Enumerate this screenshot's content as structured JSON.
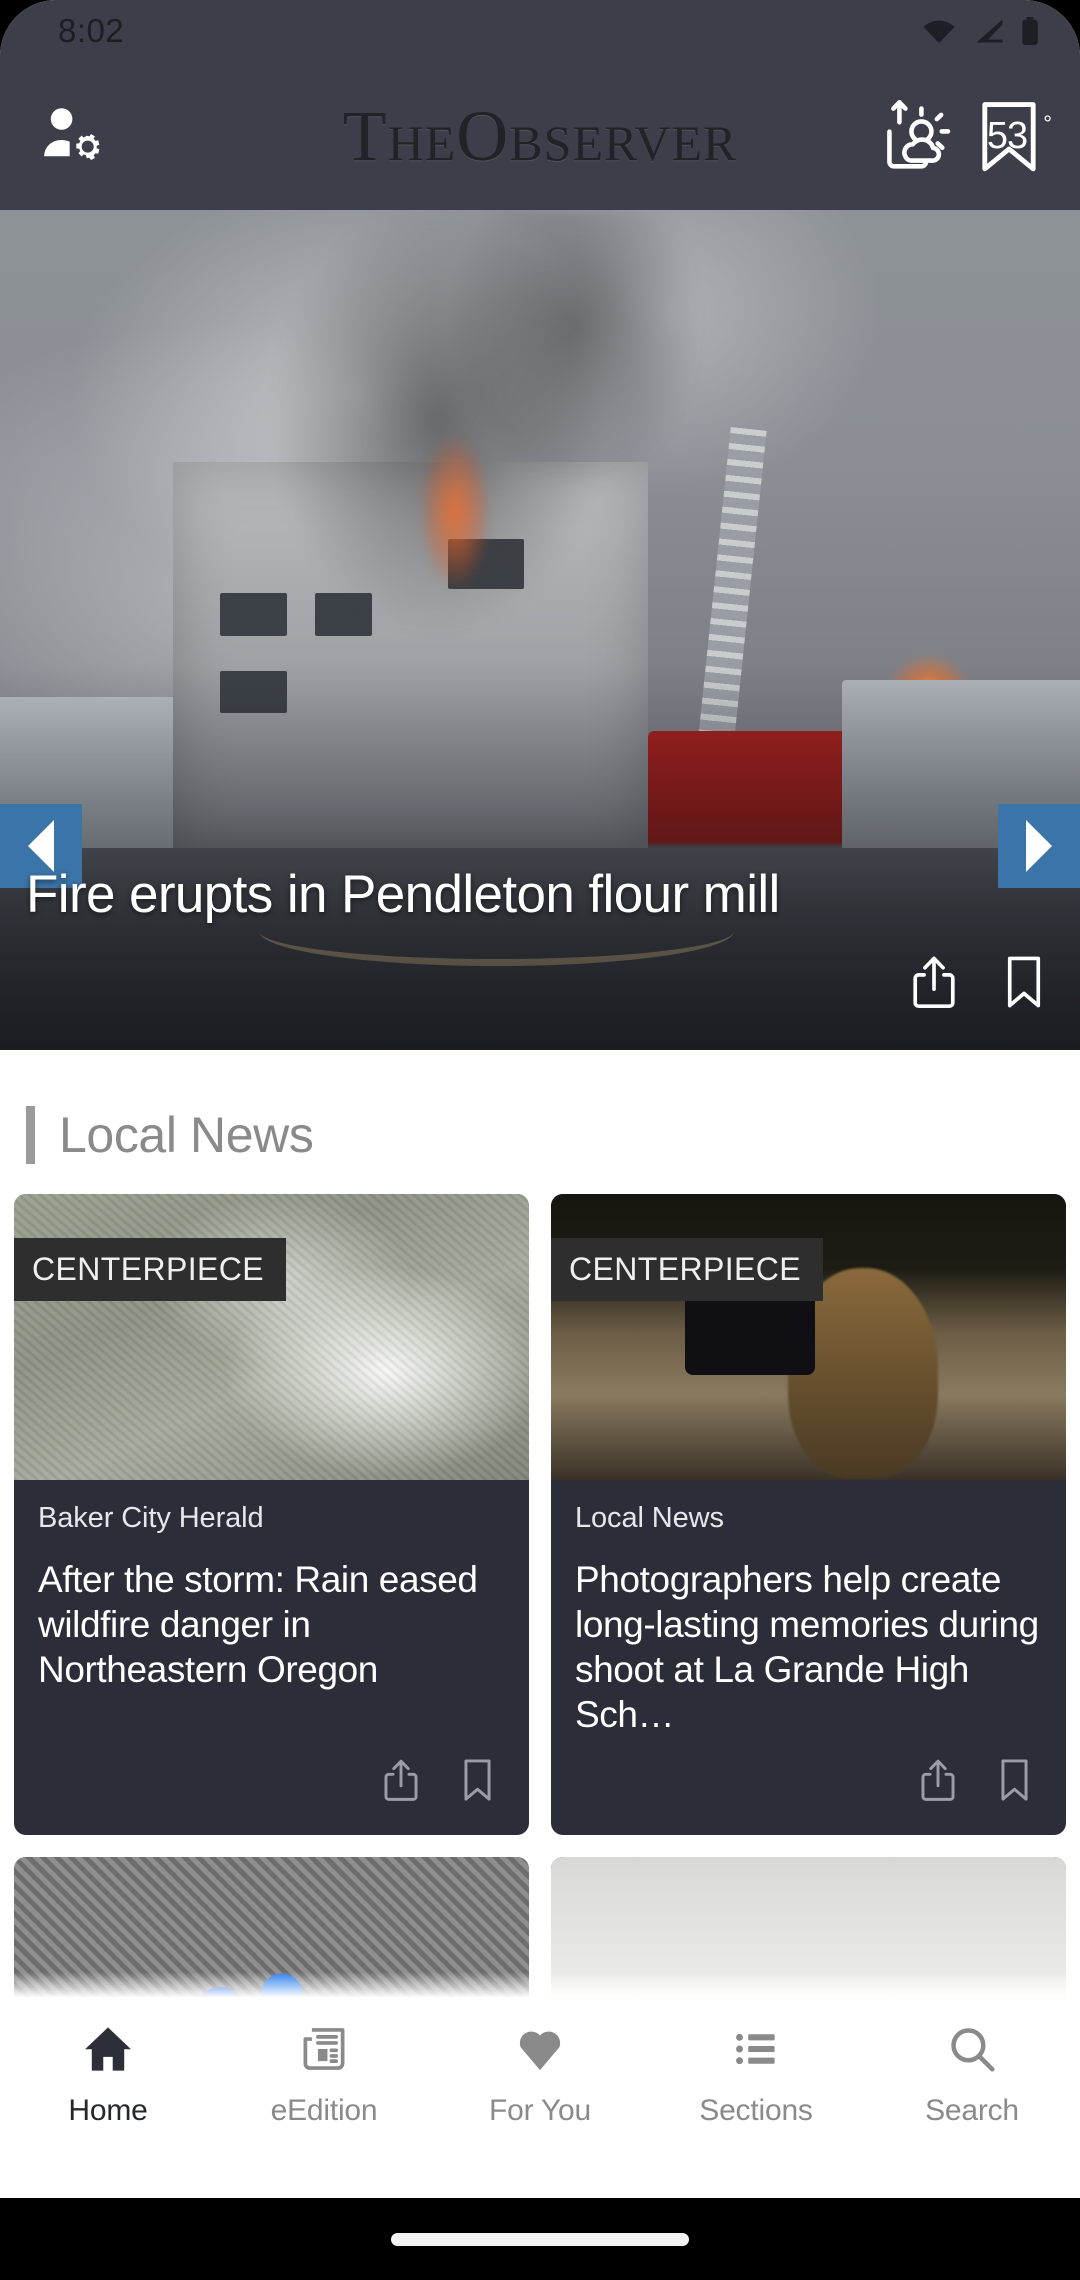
{
  "status_bar": {
    "time": "8:02",
    "icons": [
      "wifi-icon",
      "cellular-signal-icon",
      "battery-icon"
    ]
  },
  "app_header": {
    "account_icon": "account-settings-icon",
    "masthead_the": "T",
    "masthead_he": "HE",
    "masthead_o": "O",
    "masthead_bserver": "BSERVER",
    "masthead_full": "THE OBSERVER",
    "weather_icon": "sun-cloud-weather-icon",
    "bookmark_icon": "bookmark-icon",
    "temperature": "53",
    "degree_symbol": "°",
    "background_color": "#3c3e49"
  },
  "hero": {
    "headline": "Fire erupts in Pendleton flour mill",
    "prev_arrow": "chevron-left-icon",
    "next_arrow": "chevron-right-icon",
    "arrow_color": "#3b74a8",
    "share_icon": "share-icon",
    "bookmark_icon": "bookmark-icon"
  },
  "section": {
    "title": "Local News",
    "accent_color": "#9b9b9b"
  },
  "cards": [
    {
      "badge": "CENTERPIECE",
      "kicker": "Baker City Herald",
      "headline": "After the storm: Rain eased wildfire danger in Northeastern Oregon",
      "share_icon": "share-icon",
      "bookmark_icon": "bookmark-icon"
    },
    {
      "badge": "CENTERPIECE",
      "kicker": "Local News",
      "headline": "Photographers help create long-lasting memories during shoot at La Grande High Sch…",
      "share_icon": "share-icon",
      "bookmark_icon": "bookmark-icon"
    }
  ],
  "bottom_nav": {
    "items": [
      {
        "label": "Home",
        "icon": "home-icon",
        "active": true
      },
      {
        "label": "eEdition",
        "icon": "newspaper-icon",
        "active": false
      },
      {
        "label": "For You",
        "icon": "heart-icon",
        "active": false
      },
      {
        "label": "Sections",
        "icon": "list-icon",
        "active": false
      },
      {
        "label": "Search",
        "icon": "search-icon",
        "active": false
      }
    ],
    "active_color": "#26272e",
    "inactive_color": "#8a8a8a"
  }
}
